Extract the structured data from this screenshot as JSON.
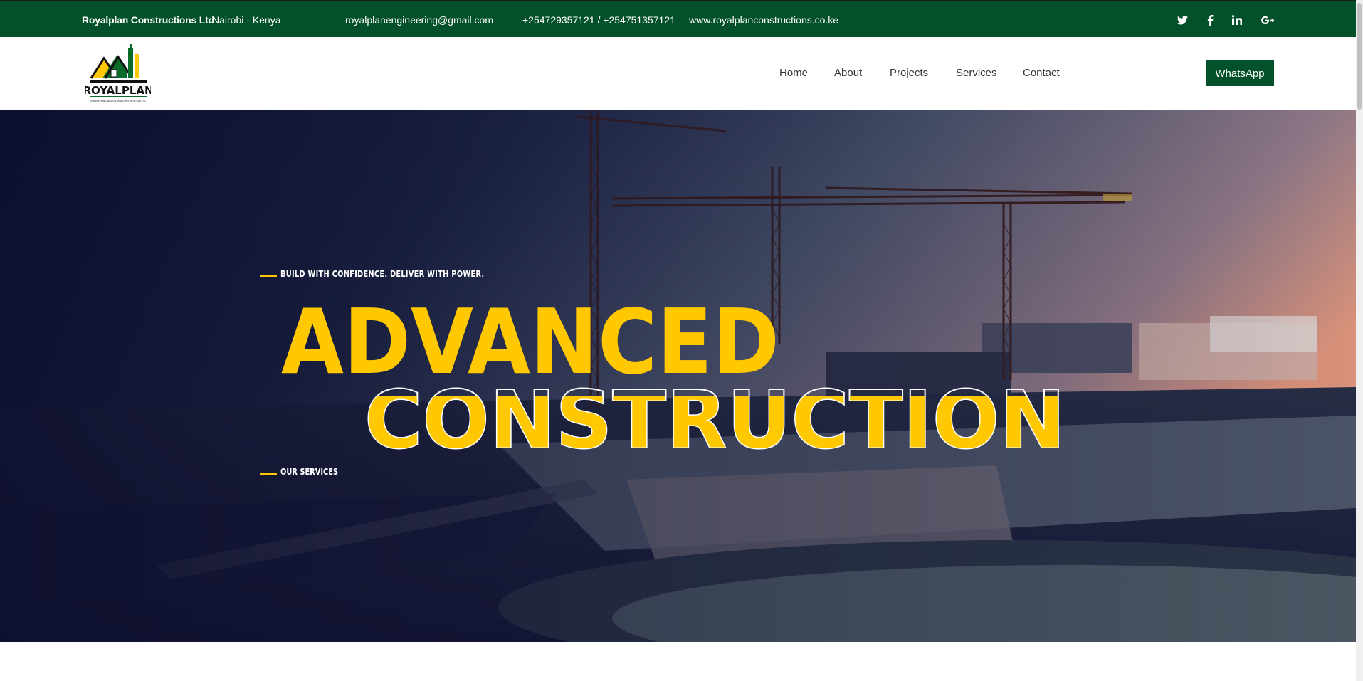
{
  "topbar": {
    "company": "Royalplan Constructions Ltd",
    "location": "Nairobi - Kenya",
    "email": "royalplanengineering@gmail.com",
    "phone": "+254729357121 / +254751357121",
    "website": "www.royalplanconstructions.co.ke",
    "social": [
      "twitter-icon",
      "facebook-icon",
      "linkedin-icon",
      "google-plus-icon"
    ]
  },
  "header": {
    "logo_text": "ROYALPLAN",
    "logo_subtext": "ENGINEERING DESIGN AND CONSTRUCTION LTD",
    "nav": [
      "Home",
      "About",
      "Projects",
      "Services",
      "Contact"
    ],
    "cta": "WhatsApp"
  },
  "hero": {
    "tagline": "BUILD WITH CONFIDENCE. DELIVER WITH POWER.",
    "title_line1": "ADVANCED",
    "title_line2": "CONSTRUCTION",
    "services_link": "OUR SERVICES"
  },
  "colors": {
    "brand_green": "#03512a",
    "accent_yellow": "#ffc800",
    "hero_dark": "#14163a"
  }
}
